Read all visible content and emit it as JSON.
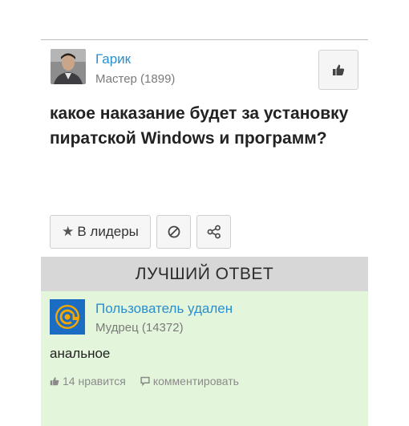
{
  "question": {
    "author_name": "Гарик",
    "author_rank": "Мастер (1899)",
    "title": "какое наказание будет за установку пиратской Windows и программ?",
    "like_icon": "thumbs-up-icon"
  },
  "actions": {
    "leader_label": "В лидеры",
    "leader_icon": "star-icon",
    "block_icon": "block-icon",
    "share_icon": "share-icon"
  },
  "best_answer": {
    "header": "ЛУЧШИЙ ОТВЕТ",
    "author_name": "Пользователь удален",
    "author_rank": "Мудрец (14372)",
    "text": "анальное",
    "likes_label": "14 нравится",
    "comment_label": "комментировать"
  },
  "colors": {
    "link": "#2a8fcf",
    "answer_bg": "#e3f6db",
    "header_bg": "#d7d7d7"
  }
}
